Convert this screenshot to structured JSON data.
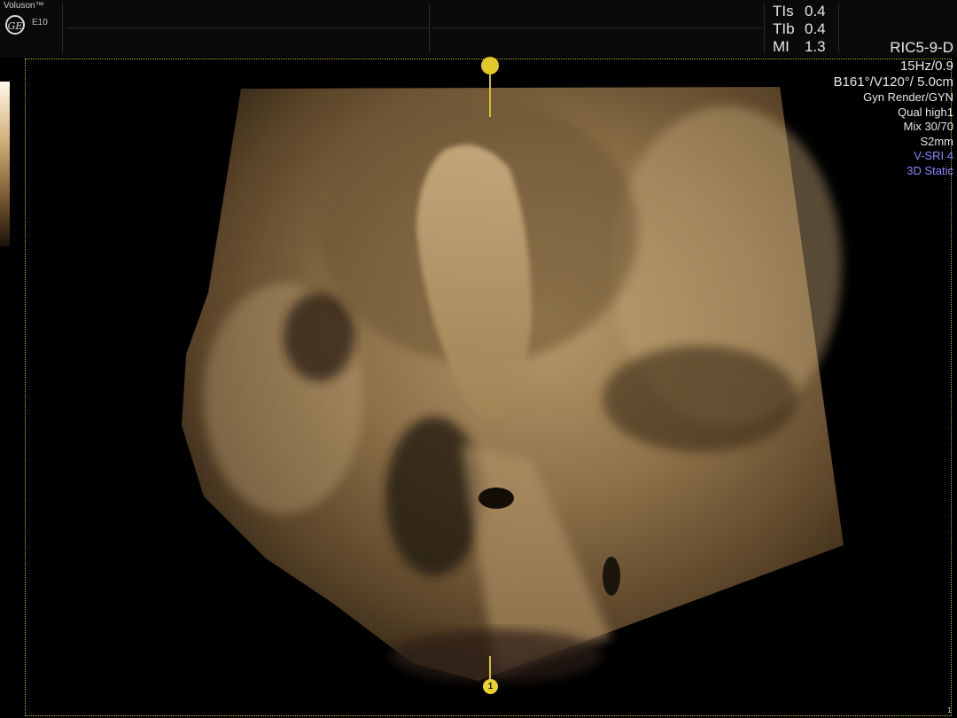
{
  "header": {
    "brand": "Voluson™",
    "logo_text": "GE",
    "model": "E10",
    "indices": [
      {
        "label": "TIs",
        "value": "0.4"
      },
      {
        "label": "TIb",
        "value": "0.4"
      },
      {
        "label": "MI",
        "value": "1.3"
      }
    ],
    "probe": "RIC5-9-D"
  },
  "params": {
    "frame_rate": "15Hz/0.9",
    "angles": "B161°/V120°/ 5.0cm",
    "render_mode": "Gyn Render/GYN",
    "quality": "Qual high1",
    "mix": "Mix 30/70",
    "slice": "S2mm",
    "vsri": "V-SRI 4",
    "static": "3D Static"
  },
  "markers": {
    "bottom_label": "1"
  },
  "footer": {
    "frame_number": "1"
  },
  "colors": {
    "accent_blue": "#8a86ff",
    "marker_yellow": "#e0c72a",
    "tissue": "#a88a5c"
  }
}
